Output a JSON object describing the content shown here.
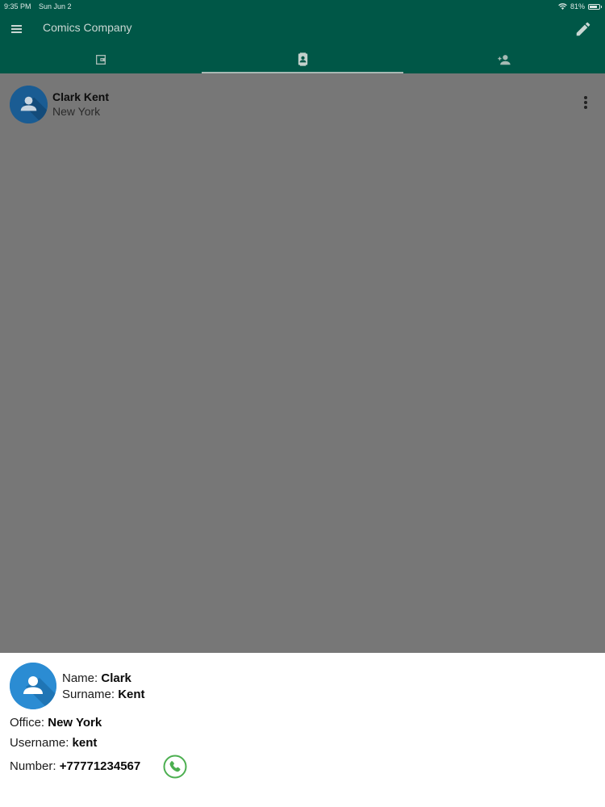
{
  "status_bar": {
    "time": "9:35 PM",
    "date": "Sun Jun 2",
    "battery_text": "81%",
    "battery_level": 0.81,
    "wifi_icon": "wifi-icon"
  },
  "app_bar": {
    "title": "Comics Company",
    "menu_icon": "menu-icon",
    "edit_icon": "edit-pencil-icon"
  },
  "tabs": [
    {
      "icon": "wallet-icon",
      "active": false
    },
    {
      "icon": "contacts-book-icon",
      "active": true
    },
    {
      "icon": "add-person-icon",
      "active": false
    }
  ],
  "contacts": [
    {
      "name": "Clark Kent",
      "city": "New York"
    }
  ],
  "details": {
    "name_label": "Name:",
    "name_value": "Clark",
    "surname_label": "Surname:",
    "surname_value": "Kent",
    "office_label": "Office:",
    "office_value": "New York",
    "username_label": "Username:",
    "username_value": "kent",
    "number_label": "Number:",
    "number_value": "+77771234567"
  },
  "colors": {
    "brand": "#005747",
    "overlay": "#777777",
    "avatar_blue": "#2b8cd3",
    "call_green": "#4caf50"
  }
}
